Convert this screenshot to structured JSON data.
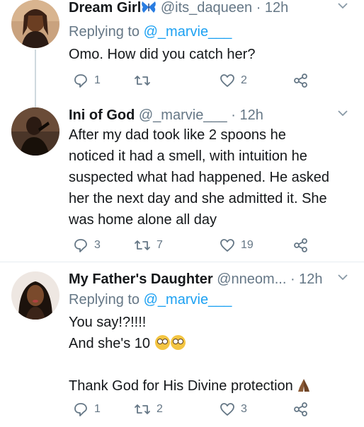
{
  "tweets": [
    {
      "display_name": "Dream Girl",
      "name_emoji": "butterfly-icon",
      "handle": "@its_daqueen",
      "time": "· 12h",
      "reply_prefix": "Replying to",
      "reply_handle": "@_marvie___",
      "text_lines": [
        "Omo. How did you catch her?"
      ],
      "replies": "1",
      "retweets": "",
      "likes": "2"
    },
    {
      "display_name": "Ini of God",
      "handle": "@_marvie___",
      "time": "· 12h",
      "text_lines": [
        "After my dad took like 2 spoons he",
        "noticed it had a smell, with intuition he",
        "suspected what had happened. He asked",
        "her the next day and she admitted it. She",
        "was home alone all day"
      ],
      "replies": "3",
      "retweets": "7",
      "likes": "19"
    },
    {
      "display_name": "My Father's Daughter",
      "handle": "@nneom...",
      "time": "· 12h",
      "reply_prefix": "Replying to",
      "reply_handle": "@_marvie___",
      "text_lines": [
        "You say!?!!!!",
        "And she's 10",
        "",
        "Thank God for His Divine protection"
      ],
      "replies": "1",
      "retweets": "2",
      "likes": "3"
    }
  ],
  "colors": {
    "accent": "#1da1f2",
    "secondary_text": "#657786",
    "primary_text": "#14171a",
    "divider": "#e6ecf0"
  }
}
